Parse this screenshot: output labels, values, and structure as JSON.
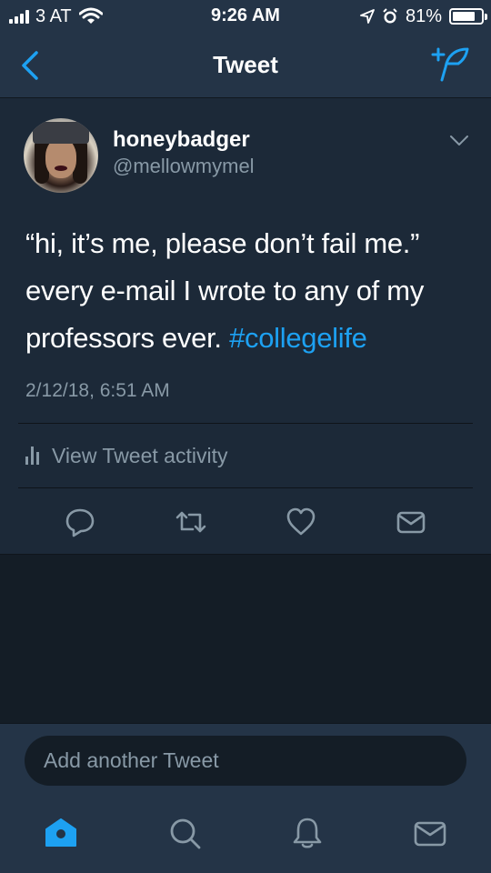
{
  "status_bar": {
    "carrier": "3 AT",
    "time": "9:26 AM",
    "battery": "81%",
    "battery_level": 0.81,
    "icons": [
      "signal-icon",
      "wifi-icon",
      "location-icon",
      "alarm-icon",
      "battery-icon"
    ]
  },
  "nav": {
    "title": "Tweet",
    "back_icon": "chevron-left-icon",
    "compose_icon": "compose-tweet-icon"
  },
  "tweet": {
    "display_name": "honeybadger",
    "handle": "@mellowmymel",
    "text": "“hi, it’s me, please don’t fail me.” every e-mail I wrote to any of my professors ever. ",
    "hashtag": "#collegelife",
    "timestamp": "2/12/18, 6:51 AM",
    "activity_label": "View Tweet activity",
    "actions": [
      "reply-icon",
      "retweet-icon",
      "like-icon",
      "direct-message-icon"
    ]
  },
  "composer": {
    "placeholder": "Add another Tweet"
  },
  "tab_bar": {
    "tabs": [
      "home-icon",
      "search-icon",
      "notifications-icon",
      "messages-icon"
    ],
    "active": "home-icon"
  },
  "colors": {
    "background": "#141d26",
    "bar": "#243447",
    "card": "#1c2938",
    "accent": "#1da1f2",
    "secondary_text": "#8899a6"
  }
}
